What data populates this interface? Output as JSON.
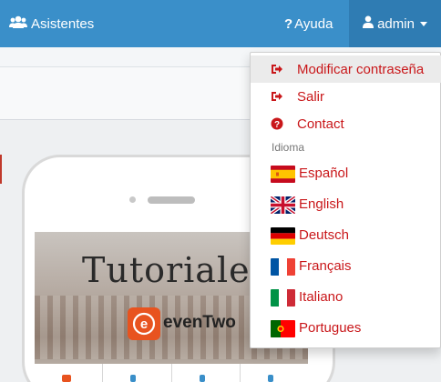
{
  "navbar": {
    "asistentes_label": "Asistentes",
    "ayuda_label": "Ayuda",
    "admin_label": "admin"
  },
  "dropdown": {
    "items": [
      {
        "label": "Modificar contraseña",
        "icon": "sign-out-icon"
      },
      {
        "label": "Salir",
        "icon": "sign-out-icon"
      },
      {
        "label": "Contact",
        "icon": "question-circle-icon"
      }
    ],
    "header": "Idioma",
    "languages": [
      {
        "label": "Español",
        "flag": "flag-spain-icon"
      },
      {
        "label": "English",
        "flag": "flag-uk-icon"
      },
      {
        "label": "Deutsch",
        "flag": "flag-germany-icon"
      },
      {
        "label": "Français",
        "flag": "flag-france-icon"
      },
      {
        "label": "Italiano",
        "flag": "flag-italy-icon"
      },
      {
        "label": "Portugues",
        "flag": "flag-portugal-icon"
      }
    ]
  },
  "preview": {
    "title": "Tutoriales",
    "logo_letter": "e",
    "logo_text": "evenTwo"
  },
  "colors": {
    "navbar": "#3a8fc9",
    "navbar_active": "#2f7cb3",
    "link": "#c9171a",
    "brand": "#e8531f"
  }
}
